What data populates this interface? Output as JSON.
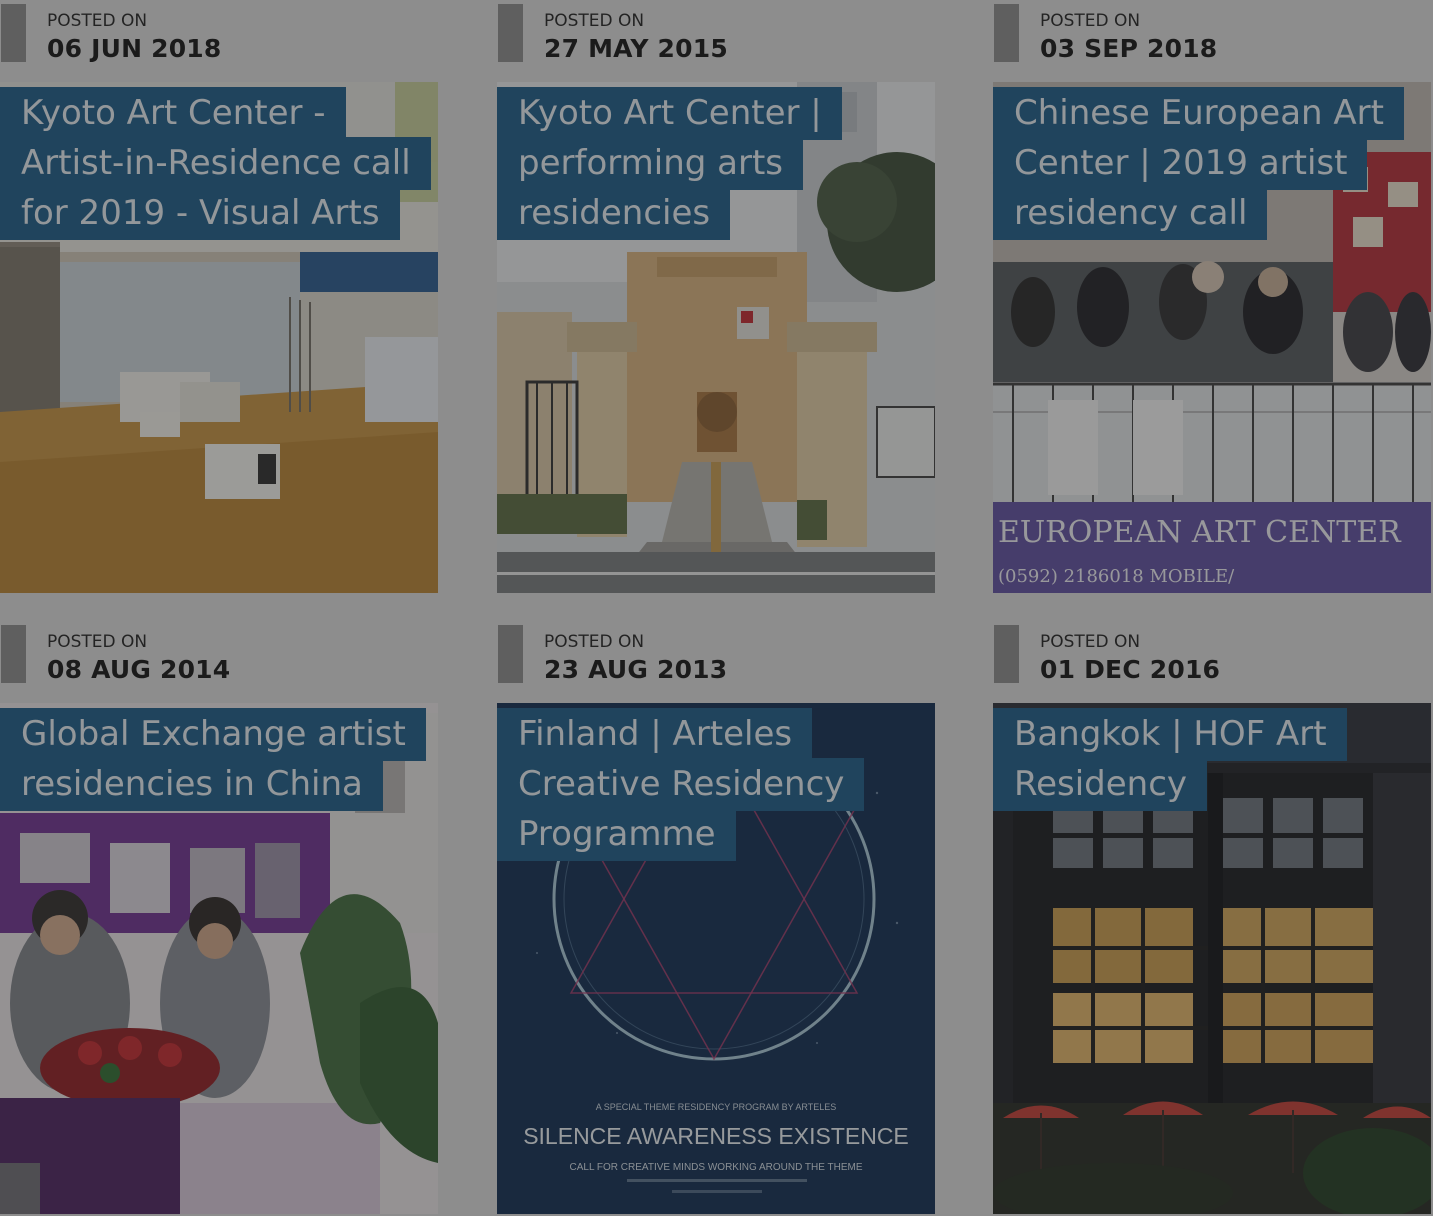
{
  "posts": [
    {
      "posted_label": "POSTED ON",
      "date": "06 JUN 2018",
      "title": "Kyoto Art Center - Artist-in-Residence call for 2019 - Visual Arts",
      "image_icon": "gallery-interior-image"
    },
    {
      "posted_label": "POSTED ON",
      "date": "27 MAY 2015",
      "title": "Kyoto Art Center | performing arts residencies",
      "image_icon": "building-gate-image"
    },
    {
      "posted_label": "POSTED ON",
      "date": "03 SEP 2018",
      "title": "Chinese European Art Center | 2019 artist residency call",
      "image_icon": "group-photo-image",
      "image_text": "EUROPEAN ART CENTER",
      "image_subtext": "(0592) 2186018    MOBILE/"
    },
    {
      "posted_label": "POSTED ON",
      "date": "08 AUG 2014",
      "title": "Global Exchange artist residencies in China",
      "image_icon": "exhibition-booth-image"
    },
    {
      "posted_label": "POSTED ON",
      "date": "23 AUG 2013",
      "title": "Finland | Arteles Creative Residency Programme",
      "image_icon": "poster-circle-image",
      "image_text": "SILENCE AWARENESS EXISTENCE",
      "image_subtext": "CALL FOR CREATIVE MINDS WORKING AROUND THE THEME",
      "image_smalltext": "A SPECIAL THEME RESIDENCY PROGRAM BY ARTELES"
    },
    {
      "posted_label": "POSTED ON",
      "date": "01 DEC 2016",
      "title": "Bangkok | HOF Art Residency",
      "image_icon": "building-night-image"
    }
  ],
  "colors": {
    "title_bg": "#1a5a86",
    "title_text": "#e7eef3",
    "page_bg": "#dcdcdc",
    "overlay": "rgba(40,40,40,0.44)"
  }
}
